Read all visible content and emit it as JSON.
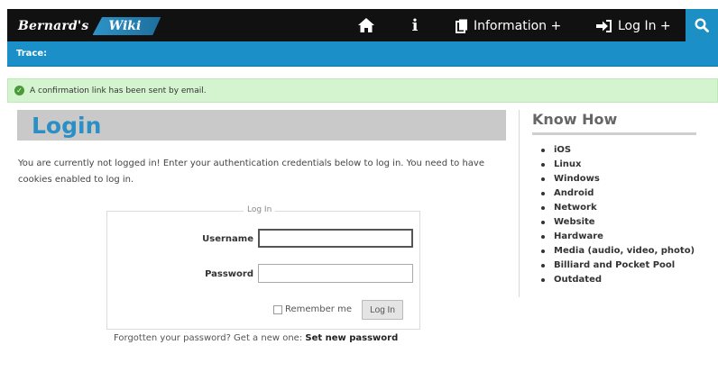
{
  "header": {
    "logo_part1": "Bernard's",
    "logo_part2": "Wiki",
    "nav_information": "Information +",
    "nav_login": "Log In +",
    "icons": [
      "home-icon",
      "info-icon",
      "document-icon",
      "sign-in-icon",
      "search-icon"
    ],
    "accent": "#1b8fc8"
  },
  "trace": {
    "label": "Trace:"
  },
  "message": {
    "text": "A confirmation link has been sent by email.",
    "status_color": "#d4f4cf"
  },
  "main": {
    "title": "Login",
    "intro": "You are currently not logged in! Enter your authentication credentials below to log in. You need to have cookies enabled to log in.",
    "form": {
      "legend": "Log In",
      "username_label": "Username",
      "username_value": "",
      "password_label": "Password",
      "password_value": "",
      "remember_label": "Remember me",
      "remember_checked": false,
      "submit_label": "Log In"
    },
    "forgot_text": "Forgotten your password? Get a new one:",
    "forgot_link": "Set new password"
  },
  "sidebar": {
    "title": "Know How",
    "items": [
      {
        "label": "iOS"
      },
      {
        "label": "Linux"
      },
      {
        "label": "Windows"
      },
      {
        "label": "Android"
      },
      {
        "label": "Network"
      },
      {
        "label": "Website"
      },
      {
        "label": "Hardware"
      },
      {
        "label": "Media (audio, video, photo)"
      },
      {
        "label": "Billiard and Pocket Pool"
      },
      {
        "label": "Outdated"
      }
    ]
  }
}
